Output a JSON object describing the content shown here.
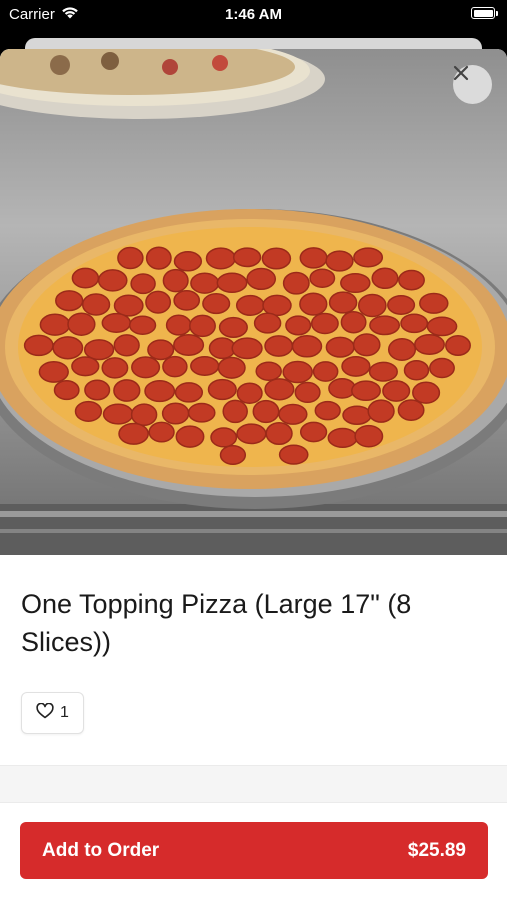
{
  "status_bar": {
    "carrier": "Carrier",
    "time": "1:46 AM"
  },
  "product": {
    "title": "One Topping Pizza (Large 17\" (8 Slices))",
    "like_count": "1"
  },
  "actions": {
    "close_icon": "close-icon",
    "add_label": "Add to Order",
    "price": "$25.89"
  },
  "colors": {
    "accent": "#d62b2b",
    "background": "#ffffff"
  }
}
